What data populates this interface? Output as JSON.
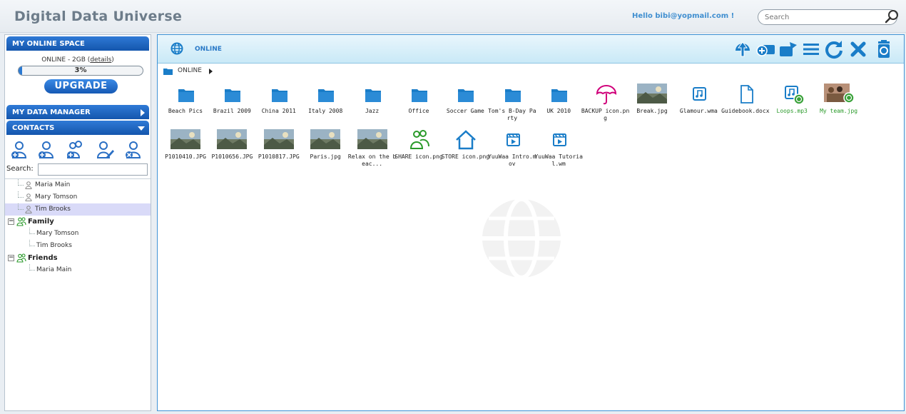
{
  "app": {
    "title": "Digital Data Universe"
  },
  "header": {
    "greeting": "Hello bibi@yopmail.com !",
    "search_placeholder": "Search"
  },
  "sidebar": {
    "online_space": {
      "title": "MY ONLINE SPACE",
      "plan_text": "ONLINE - 2GB",
      "details_link": "details",
      "usage_percent_label": "3%",
      "usage_fraction": 0.03,
      "upgrade_label": "UPGRADE"
    },
    "data_manager": {
      "title": "MY DATA MANAGER"
    },
    "contacts": {
      "title": "CONTACTS",
      "search_label": "Search:",
      "tools": [
        "add-contact-icon",
        "add-contact-icon",
        "add-group-icon",
        "edit-contact-icon",
        "remove-contact-icon"
      ],
      "people": [
        "Maria Main",
        "Mary Tomson",
        "Tim Brooks"
      ],
      "selected": "Tim Brooks",
      "groups": [
        {
          "name": "Family",
          "members": [
            "Mary Tomson",
            "Tim Brooks"
          ]
        },
        {
          "name": "Friends",
          "members": [
            "Maria Main"
          ]
        }
      ]
    }
  },
  "main": {
    "title": "ONLINE",
    "breadcrumb": "ONLINE",
    "toolbar": [
      "upload-icon",
      "add-folder-icon",
      "move-icon",
      "list-view-icon",
      "refresh-icon",
      "delete-icon",
      "trash-icon"
    ],
    "colors": {
      "accent": "#1a7dc8",
      "share_green": "#2a9a2a",
      "backup_magenta": "#d0007a"
    },
    "items": [
      {
        "name": "Beach Pics",
        "kind": "folder"
      },
      {
        "name": "Brazil 2009",
        "kind": "folder"
      },
      {
        "name": "China 2011",
        "kind": "folder"
      },
      {
        "name": "Italy 2008",
        "kind": "folder"
      },
      {
        "name": "Jazz",
        "kind": "folder"
      },
      {
        "name": "Office",
        "kind": "folder"
      },
      {
        "name": "Soccer Game",
        "kind": "folder"
      },
      {
        "name": "Tom's B-Day Party",
        "kind": "folder"
      },
      {
        "name": "UK 2010",
        "kind": "folder"
      },
      {
        "name": "BACKUP icon.png",
        "kind": "umbrella"
      },
      {
        "name": "Break.jpg",
        "kind": "photo"
      },
      {
        "name": "Glamour.wma",
        "kind": "audio"
      },
      {
        "name": "Guidebook.docx",
        "kind": "doc"
      },
      {
        "name": "Loops.mp3",
        "kind": "audio-shared"
      },
      {
        "name": "My team.jpg",
        "kind": "photo-shared"
      },
      {
        "name": "P1010410.JPG",
        "kind": "photo"
      },
      {
        "name": "P1010656.JPG",
        "kind": "photo"
      },
      {
        "name": "P1010817.JPG",
        "kind": "photo"
      },
      {
        "name": "Paris.jpg",
        "kind": "photo"
      },
      {
        "name": "Relax on the beac...",
        "kind": "photo"
      },
      {
        "name": "SHARE icon.png",
        "kind": "share"
      },
      {
        "name": "STORE icon.png",
        "kind": "store"
      },
      {
        "name": "YuuWaa Intro.mov",
        "kind": "video"
      },
      {
        "name": "YuuWaa Tutorial.wm",
        "kind": "video"
      }
    ]
  }
}
